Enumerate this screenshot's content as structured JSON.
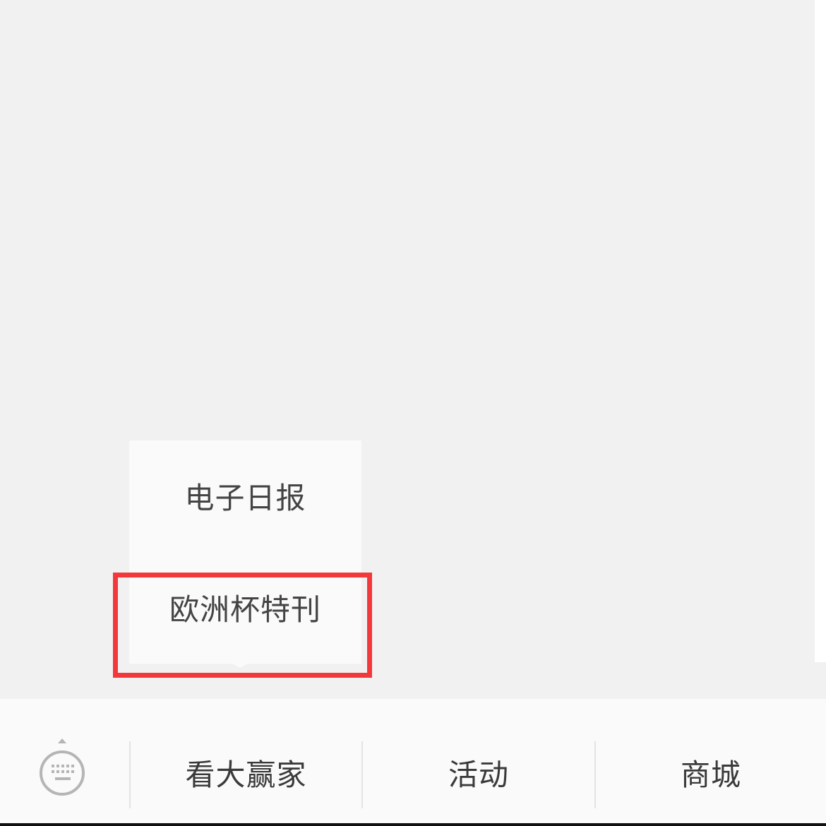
{
  "popup_menu": {
    "items": [
      {
        "label": "电子日报"
      },
      {
        "label": "欧洲杯特刊"
      }
    ]
  },
  "highlight": {
    "color": "#f2383b"
  },
  "bottom_bar": {
    "keyboard_icon": "keyboard-icon",
    "tabs": [
      {
        "label": "看大赢家"
      },
      {
        "label": "活动"
      },
      {
        "label": "商城"
      }
    ]
  },
  "colors": {
    "background": "#f1f1f1",
    "menu_bg": "#fafafa",
    "text": "#444444",
    "divider": "#e3e3e3"
  }
}
